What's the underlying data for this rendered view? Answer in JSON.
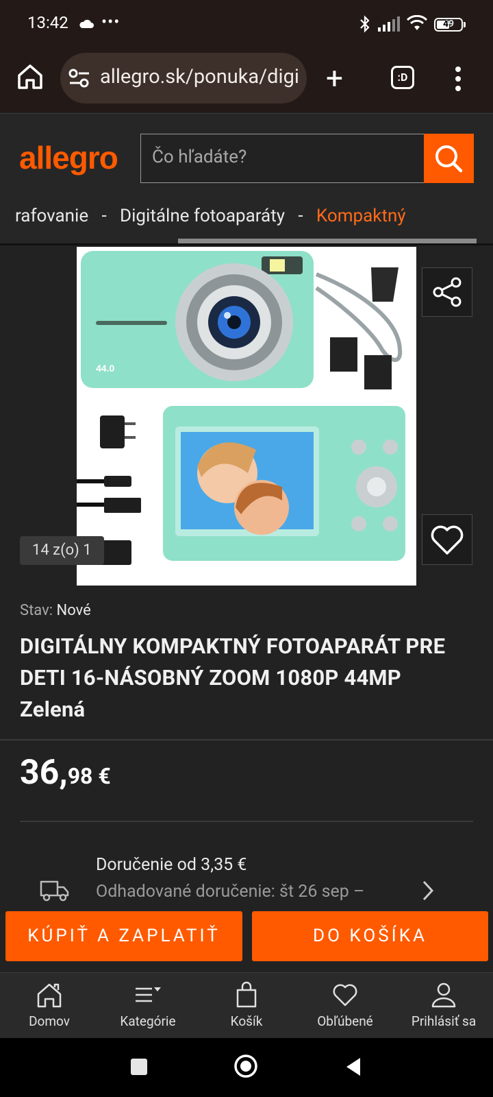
{
  "status_bar": {
    "time": "13:42",
    "overflow": "•••",
    "battery": "49"
  },
  "browser": {
    "url": "allegro.sk/ponuka/digi",
    "tabs_label": ":D"
  },
  "header": {
    "logo": "allegro",
    "search_placeholder": "Čo hľadáte?",
    "breadcrumb": {
      "item1": "rafovanie",
      "sep": "-",
      "item2": "Digitálne fotoaparáty",
      "item3": "Kompaktný"
    }
  },
  "gallery": {
    "count": "14 z(o) 1"
  },
  "product": {
    "condition_label": "Stav:",
    "condition_value": "Nové",
    "title": "DIGITÁLNY KOMPAKTNÝ FOTOAPARÁT PRE DETI 16-NÁSOBNÝ ZOOM 1080P 44MP Zelená",
    "price_int": "36,",
    "price_dec": "98",
    "currency": "€",
    "delivery_from": "Doručenie od 3,35 €",
    "delivery_estimate": "Odhadované doručenie: št 26 sep –"
  },
  "actions": {
    "buy": "KÚPIŤ A ZAPLATIŤ",
    "cart": "DO KOŠÍKA"
  },
  "nav": [
    {
      "label": "Domov"
    },
    {
      "label": "Kategórie"
    },
    {
      "label": "Košík"
    },
    {
      "label": "Obľúbené"
    },
    {
      "label": "Prihlásiť sa"
    }
  ],
  "colors": {
    "accent": "#ff5a00",
    "background": "#222222",
    "browser_bar": "#231a17"
  }
}
